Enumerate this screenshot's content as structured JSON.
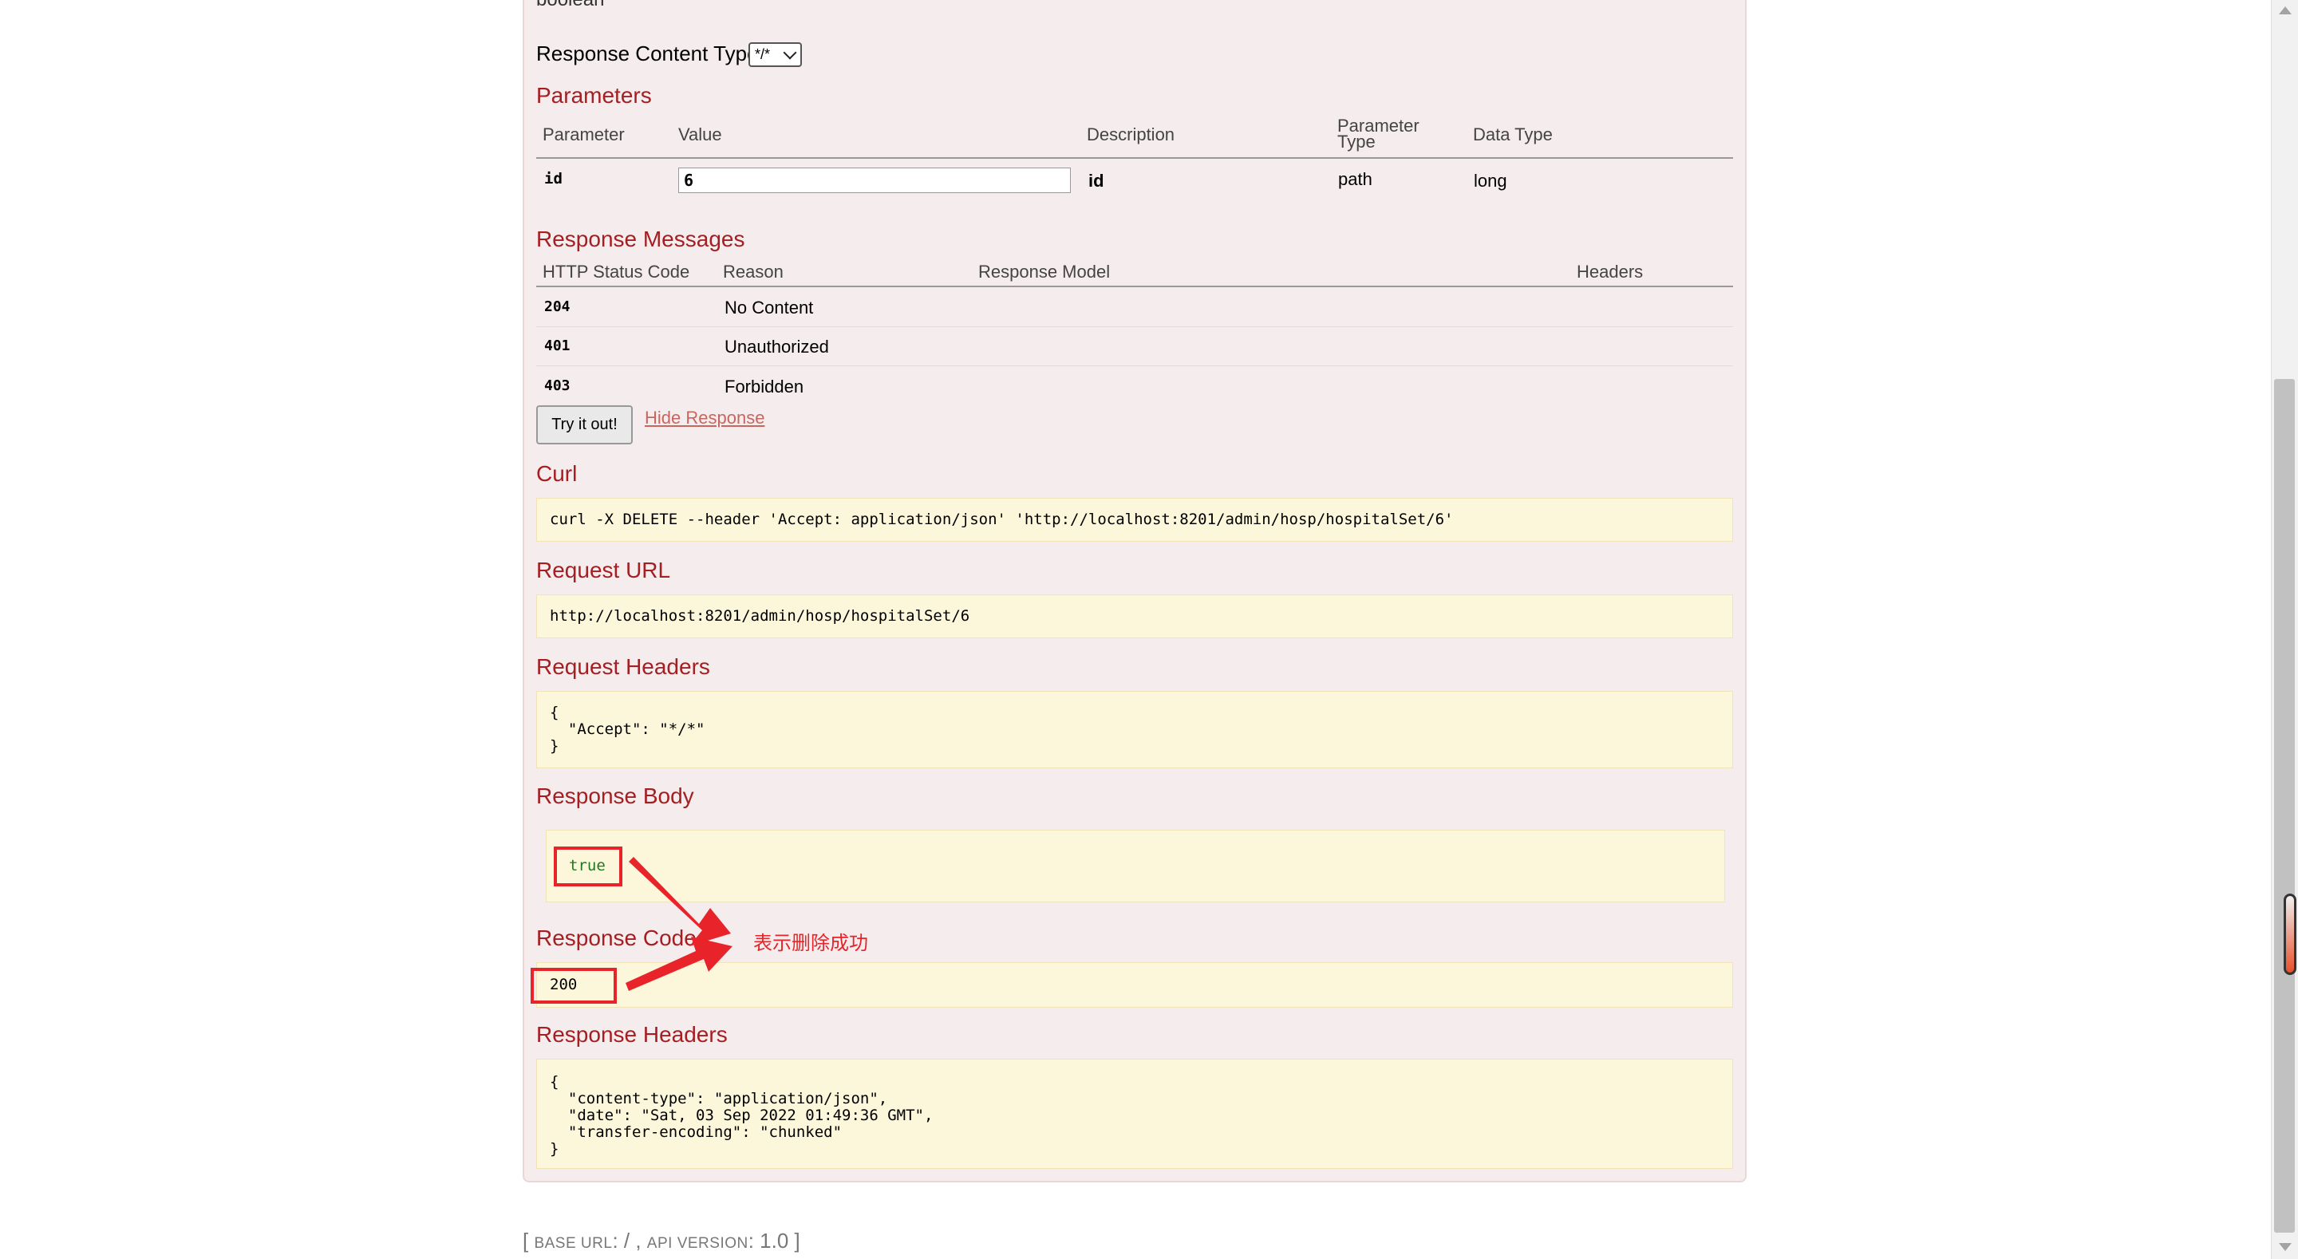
{
  "cut_text": "boolean",
  "response_content_type": {
    "label": "Response Content Type",
    "selected": "*/*"
  },
  "parameters": {
    "title": "Parameters",
    "headers": [
      "Parameter",
      "Value",
      "Description",
      "Parameter\nType",
      "Data Type"
    ],
    "row": {
      "parameter": "id",
      "value": "6",
      "description": "id",
      "type": "path",
      "data_type": "long"
    }
  },
  "response_messages": {
    "title": "Response Messages",
    "headers": [
      "HTTP Status Code",
      "Reason",
      "Response Model",
      "Headers"
    ],
    "rows": [
      {
        "code": "204",
        "reason": "No Content"
      },
      {
        "code": "401",
        "reason": "Unauthorized"
      },
      {
        "code": "403",
        "reason": "Forbidden"
      }
    ]
  },
  "actions": {
    "try_label": "Try it out!",
    "hide_label": "Hide Response"
  },
  "curl": {
    "title": "Curl",
    "text": "curl -X DELETE --header 'Accept: application/json' 'http://localhost:8201/admin/hosp/hospitalSet/6'"
  },
  "request_url": {
    "title": "Request URL",
    "text": "http://localhost:8201/admin/hosp/hospitalSet/6"
  },
  "request_headers": {
    "title": "Request Headers",
    "text": "{\n  \"Accept\": \"*/*\"\n}"
  },
  "response_body": {
    "title": "Response Body",
    "text": "true"
  },
  "response_code": {
    "title": "Response Code",
    "text": "200"
  },
  "annotation": "表示删除成功",
  "response_headers": {
    "title": "Response Headers",
    "text": "{\n  \"content-type\": \"application/json\",\n  \"date\": \"Sat, 03 Sep 2022 01:49:36 GMT\",\n  \"transfer-encoding\": \"chunked\"\n}"
  },
  "footer": {
    "base_url_label": "base url",
    "base_url": "/",
    "api_version_label": "api version",
    "api_version": "1.0"
  },
  "colors": {
    "heading": "#a41e22",
    "highlight": "#e8232a",
    "code_bg": "#fcf6db",
    "panel_bg": "#f5eded"
  }
}
